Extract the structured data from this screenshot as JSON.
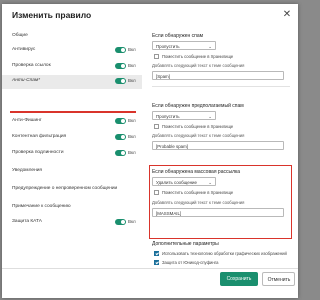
{
  "dialog": {
    "title": "Изменить правило",
    "close_glyph": "✕"
  },
  "sidebar": {
    "toggle_on_label": "Вкл",
    "items": [
      {
        "label": "Общие",
        "has_toggle": false
      },
      {
        "label": "Антивирус",
        "has_toggle": true
      },
      {
        "label": "Проверка ссылок",
        "has_toggle": true
      },
      {
        "label": "Анти-Спам*",
        "has_toggle": true,
        "active": true
      },
      {
        "label": "Анти-Фишинг",
        "has_toggle": true
      },
      {
        "label": "Контентная фильтрация",
        "has_toggle": true
      },
      {
        "label": "Проверка подлинности",
        "has_toggle": true
      },
      {
        "label": "Уведомления",
        "has_toggle": false
      },
      {
        "label": "Предупреждение о непроверенном сообщении",
        "has_toggle": false
      },
      {
        "label": "Примечание к сообщению",
        "has_toggle": false
      },
      {
        "label": "Защита КАТА",
        "has_toggle": true
      }
    ]
  },
  "main": {
    "spam": {
      "title": "Если обнаружен спам",
      "action": "Пропустить",
      "backup_label": "Поместить сообщение в Хранилище",
      "hint": "Добавлять следующий текст к теме сообщения",
      "value": "[Spam]"
    },
    "probable_spam": {
      "title": "Если обнаружен предполагаемый спам",
      "action": "Пропустить",
      "backup_label": "Поместить сообщение в Хранилище",
      "hint": "Добавлять следующий текст к теме сообщения",
      "value": "[Probable spam]"
    },
    "mass_mailing": {
      "title": "Если обнаружена массовая рассылка",
      "action": "Удалить сообщение",
      "backup_label": "Поместить сообщение в Хранилище",
      "hint": "Добавлять следующий текст к теме сообщения",
      "value": "[MASSMAIL]"
    },
    "additional": {
      "title": "Дополнительные параметры",
      "option1": "Использовать технологию обработки графических изображений",
      "option2": "Защита от Юникод-спуфинга"
    }
  },
  "footer": {
    "save_label": "Сохранить",
    "cancel_label": "Отменить"
  },
  "colors": {
    "accent": "#1a8f6e",
    "highlight": "#d9342b",
    "checkbox_checked": "#1a6f9a"
  }
}
